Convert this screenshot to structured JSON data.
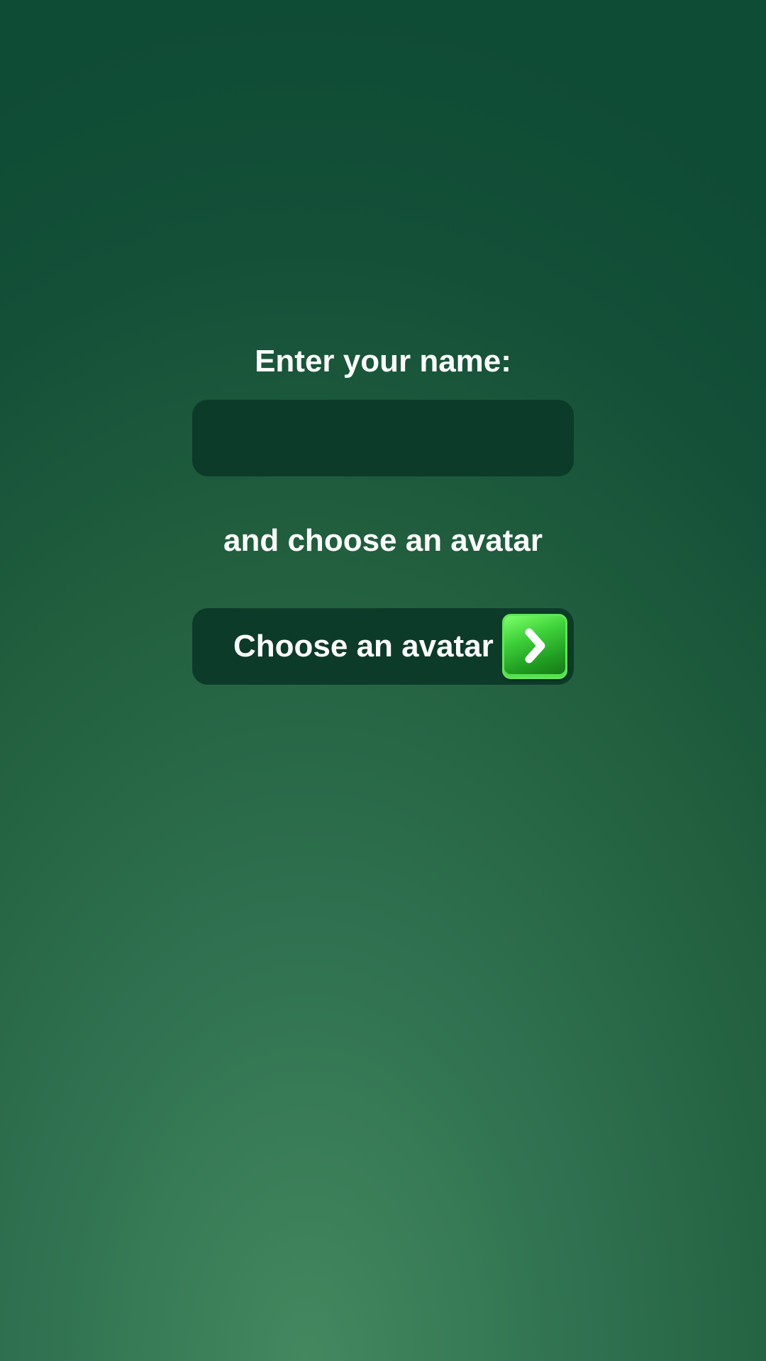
{
  "screen": {
    "title": "Enter your name:",
    "subtitle": "and choose an avatar"
  },
  "name_input": {
    "value": "",
    "placeholder": ""
  },
  "avatar_button": {
    "label": "Choose an avatar",
    "icon": "chevron-right-icon"
  },
  "colors": {
    "background_dark": "#0f4c35",
    "background_light": "#43885f",
    "field_background": "#0d3b29",
    "accent_green": "#3fd23a",
    "text": "#ffffff"
  }
}
